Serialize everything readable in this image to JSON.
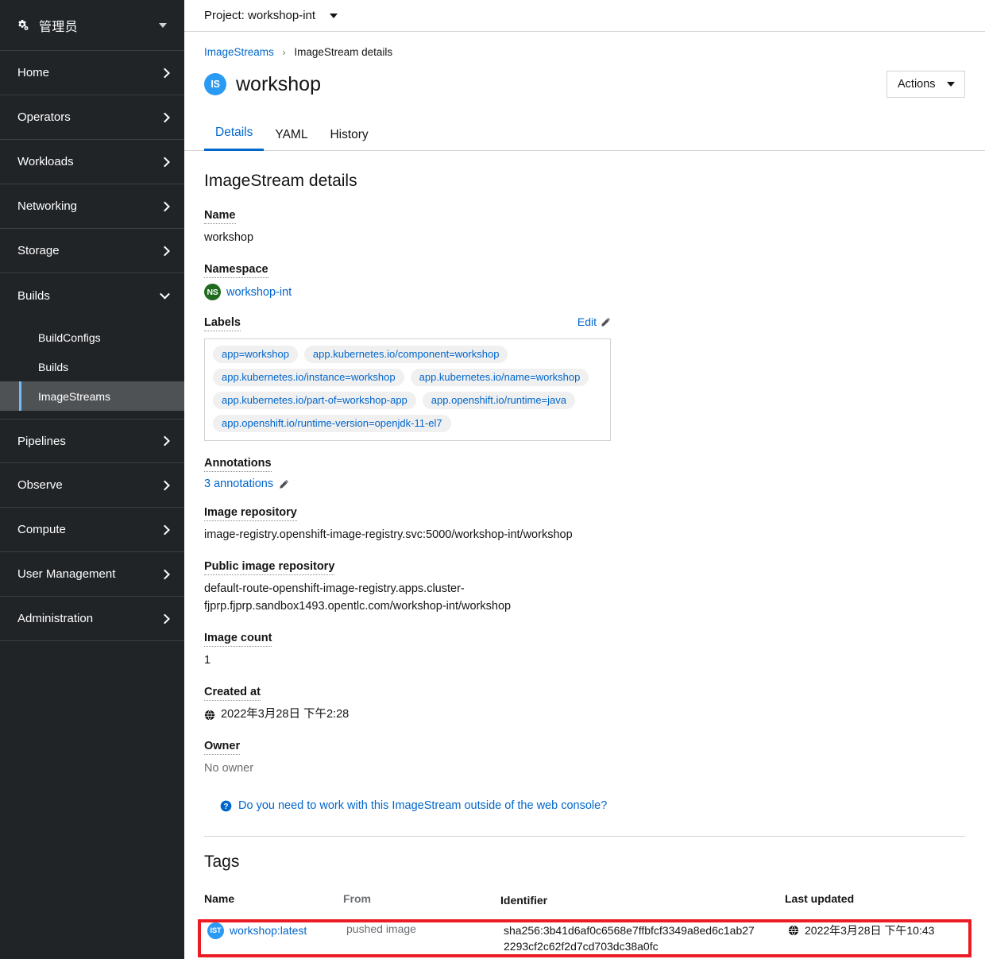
{
  "sidebar": {
    "perspective": {
      "label": "管理员",
      "icon": "gear-icon"
    },
    "items": [
      {
        "label": "Home",
        "expandable": true,
        "expanded": false
      },
      {
        "label": "Operators",
        "expandable": true,
        "expanded": false
      },
      {
        "label": "Workloads",
        "expandable": true,
        "expanded": false
      },
      {
        "label": "Networking",
        "expandable": true,
        "expanded": false
      },
      {
        "label": "Storage",
        "expandable": true,
        "expanded": false
      },
      {
        "label": "Builds",
        "expandable": true,
        "expanded": true
      }
    ],
    "builds_subitems": [
      {
        "label": "BuildConfigs",
        "active": false
      },
      {
        "label": "Builds",
        "active": false
      },
      {
        "label": "ImageStreams",
        "active": true
      }
    ],
    "items_after": [
      {
        "label": "Pipelines",
        "expandable": true
      },
      {
        "label": "Observe",
        "expandable": true
      },
      {
        "label": "Compute",
        "expandable": true
      },
      {
        "label": "User Management",
        "expandable": true
      },
      {
        "label": "Administration",
        "expandable": true
      }
    ]
  },
  "project_bar": {
    "label": "Project: workshop-int"
  },
  "breadcrumb": {
    "parent": "ImageStreams",
    "separator": "›",
    "current": "ImageStream details"
  },
  "header": {
    "badge": "IS",
    "title": "workshop",
    "actions_label": "Actions"
  },
  "tabs": [
    {
      "label": "Details",
      "active": true
    },
    {
      "label": "YAML",
      "active": false
    },
    {
      "label": "History",
      "active": false
    }
  ],
  "details": {
    "section_title": "ImageStream details",
    "name_label": "Name",
    "name_value": "workshop",
    "namespace_label": "Namespace",
    "namespace_badge": "NS",
    "namespace_value": "workshop-int",
    "labels_label": "Labels",
    "labels_edit": "Edit",
    "labels": [
      "app=workshop",
      "app.kubernetes.io/component=workshop",
      "app.kubernetes.io/instance=workshop",
      "app.kubernetes.io/name=workshop",
      "app.kubernetes.io/part-of=workshop-app",
      "app.openshift.io/runtime=java",
      "app.openshift.io/runtime-version=openjdk-11-el7"
    ],
    "annotations_label": "Annotations",
    "annotations_value": "3 annotations",
    "image_repo_label": "Image repository",
    "image_repo_value": "image-registry.openshift-image-registry.svc:5000/workshop-int/workshop",
    "public_repo_label": "Public image repository",
    "public_repo_value_line1": "default-route-openshift-image-registry.apps.cluster-",
    "public_repo_value_line2": "fjprp.fjprp.sandbox1493.opentlc.com/workshop-int/workshop",
    "image_count_label": "Image count",
    "image_count_value": "1",
    "created_at_label": "Created at",
    "created_at_value": "2022年3月28日 下午2:28",
    "owner_label": "Owner",
    "owner_value": "No owner",
    "help_link": "Do you need to work with this ImageStream outside of the web console?"
  },
  "tags": {
    "title": "Tags",
    "columns": [
      "Name",
      "From",
      "Identifier",
      "Last updated"
    ],
    "rows": [
      {
        "badge": "IST",
        "name": "workshop:latest",
        "from": "pushed image",
        "identifier_line1": "sha256:3b41d6af0c6568e7ffbfcf3349a8ed6c1ab27",
        "identifier_line2": "2293cf2c62f2d7cd703dc38a0fc",
        "last_updated": "2022年3月28日 下午10:43",
        "highlighted": true
      }
    ]
  },
  "colors": {
    "sidebar_bg": "#212427",
    "sidebar_active": "#4f5255",
    "sidebar_accent": "#73bcf7",
    "link": "#0066cc",
    "badge_is": "#2b9af3",
    "badge_ns": "#1e6b1e",
    "highlight": "#ec1c24"
  }
}
